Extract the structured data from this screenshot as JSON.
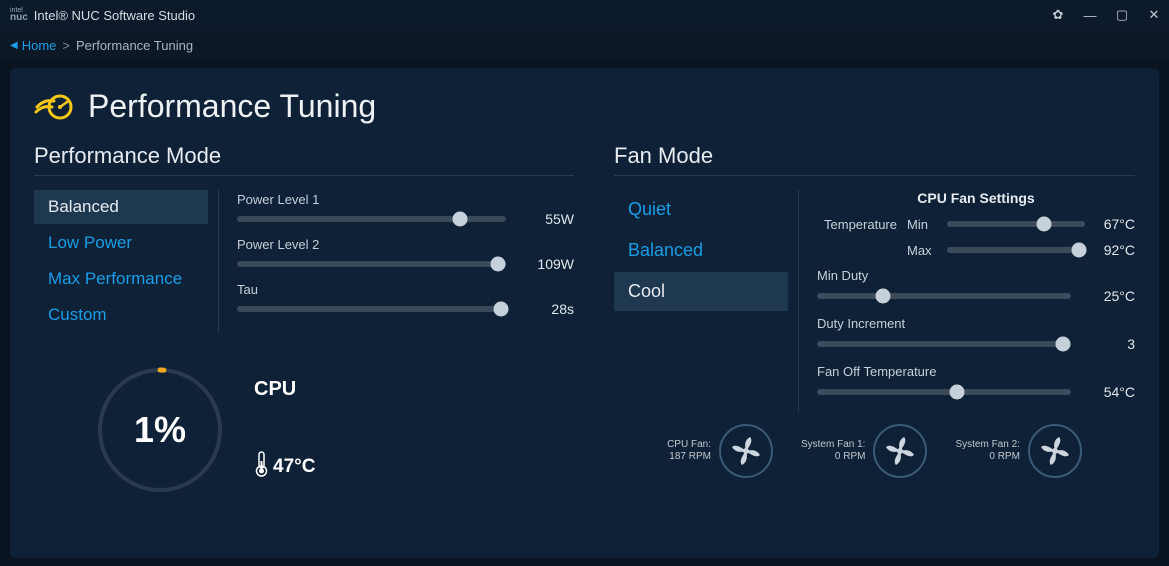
{
  "titlebar": {
    "logo": "intel nuc",
    "title": "Intel® NUC Software Studio"
  },
  "breadcrumb": {
    "home": "Home",
    "current": "Performance Tuning"
  },
  "page": {
    "title": "Performance Tuning"
  },
  "perf_mode": {
    "title": "Performance Mode",
    "tabs": {
      "balanced": "Balanced",
      "low_power": "Low Power",
      "max_perf": "Max Performance",
      "custom": "Custom"
    },
    "sliders": {
      "pl1": {
        "label": "Power Level 1",
        "value": "55W",
        "pos": 83
      },
      "pl2": {
        "label": "Power Level 2",
        "value": "109W",
        "pos": 97
      },
      "tau": {
        "label": "Tau",
        "value": "28s",
        "pos": 98
      }
    }
  },
  "cpu": {
    "label": "CPU",
    "usage": "1%",
    "temp": "47°C"
  },
  "fan_mode": {
    "title": "Fan Mode",
    "tabs": {
      "quiet": "Quiet",
      "balanced": "Balanced",
      "cool": "Cool"
    },
    "settings_title": "CPU Fan Settings",
    "temperature_label": "Temperature",
    "rows": {
      "min_temp": {
        "sub": "Min",
        "value": "67°C",
        "pos": 70
      },
      "max_temp": {
        "sub": "Max",
        "value": "92°C",
        "pos": 96
      },
      "min_duty": {
        "label": "Min Duty",
        "value": "25°C",
        "pos": 26
      },
      "duty_inc": {
        "label": "Duty Increment",
        "value": "3",
        "pos": 97
      },
      "fan_off": {
        "label": "Fan Off Temperature",
        "value": "54°C",
        "pos": 55
      }
    }
  },
  "fans": {
    "cpu": {
      "name": "CPU Fan:",
      "rpm": "187 RPM"
    },
    "sys1": {
      "name": "System Fan 1:",
      "rpm": "0 RPM"
    },
    "sys2": {
      "name": "System Fan 2:",
      "rpm": "0 RPM"
    }
  }
}
